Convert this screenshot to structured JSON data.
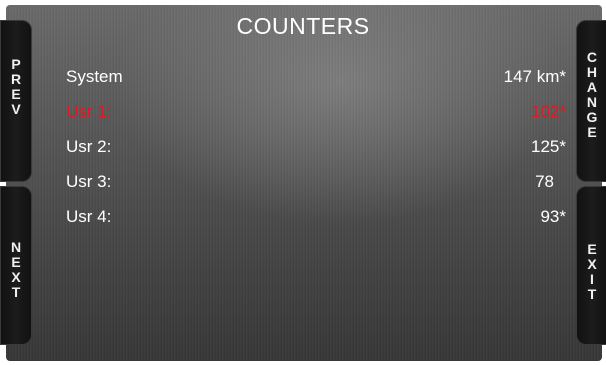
{
  "screen": {
    "title": "COUNTERS"
  },
  "softkeys": {
    "left_top": "PREV",
    "left_bottom": "NEXT",
    "right_top": "CHANGE",
    "right_bottom": "EXIT"
  },
  "counters": [
    {
      "label": "System",
      "value": "147 km*",
      "selected": false
    },
    {
      "label": "Usr 1:",
      "value": "102*",
      "selected": true
    },
    {
      "label": "Usr 2:",
      "value": "125*",
      "selected": false
    },
    {
      "label": "Usr 3:",
      "value": "78",
      "selected": false
    },
    {
      "label": "Usr 4:",
      "value": "93*",
      "selected": false
    }
  ],
  "colors": {
    "text": "#ffffff",
    "selected": "#e01a22",
    "softkey_bg": "#161616"
  }
}
